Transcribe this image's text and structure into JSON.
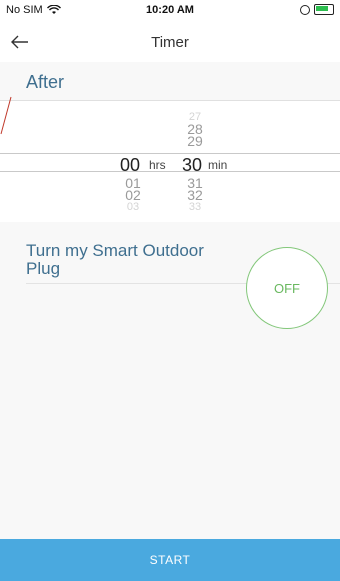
{
  "status_bar": {
    "carrier": "No SIM",
    "time": "10:20 AM"
  },
  "nav": {
    "title": "Timer"
  },
  "section": {
    "after_label": "After",
    "turn_label": "Turn my Smart Outdoor Plug"
  },
  "picker": {
    "hours_above": [
      "",
      "",
      ""
    ],
    "hours_selected": "00",
    "hours_unit": "hrs",
    "hours_below": [
      "01",
      "02",
      "03"
    ],
    "minutes_above": [
      "27",
      "28",
      "29"
    ],
    "minutes_selected": "30",
    "minutes_unit": "min",
    "minutes_below": [
      "31",
      "32",
      "33"
    ]
  },
  "toggle": {
    "state_label": "OFF",
    "accent": "#6fbf64"
  },
  "footer": {
    "start_label": "START",
    "color": "#4aa9df"
  }
}
